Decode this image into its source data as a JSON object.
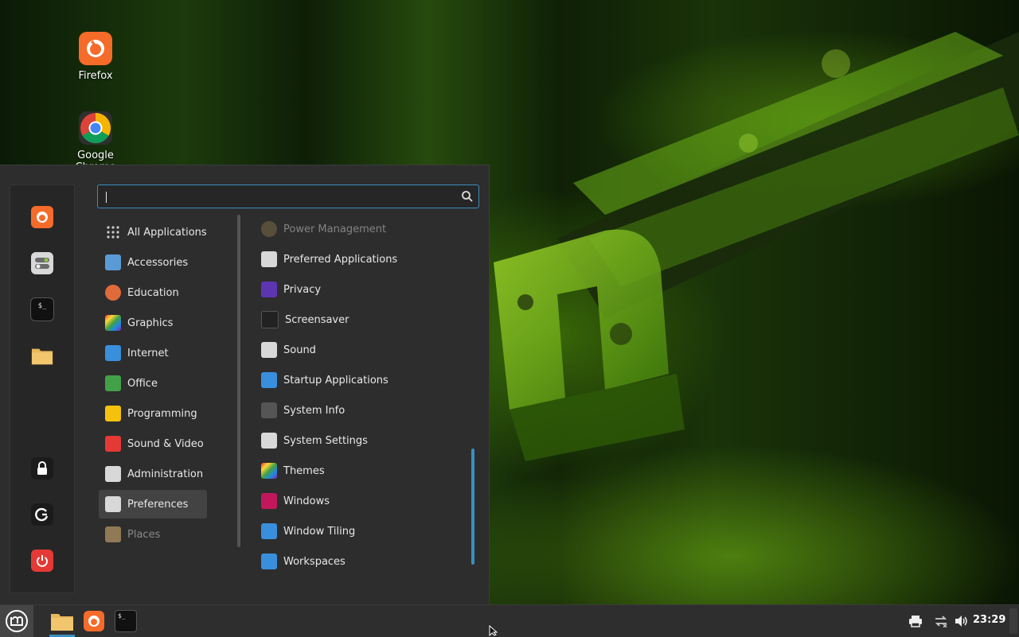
{
  "desktop": {
    "icons": [
      {
        "label": "Firefox",
        "icon": "firefox-icon"
      },
      {
        "label": "Google Chrome",
        "icon": "chrome-icon"
      }
    ]
  },
  "menu": {
    "search": {
      "value": "",
      "placeholder": ""
    },
    "favorites": [
      {
        "name": "firefox",
        "icon": "firefox-icon"
      },
      {
        "name": "system-settings",
        "icon": "settings-toggle-icon"
      },
      {
        "name": "terminal",
        "icon": "terminal-icon"
      },
      {
        "name": "files",
        "icon": "folder-icon"
      },
      {
        "name": "lock-screen",
        "icon": "lock-icon"
      },
      {
        "name": "logout",
        "icon": "logout-icon"
      },
      {
        "name": "shutdown",
        "icon": "power-icon"
      }
    ],
    "categories": [
      {
        "label": "All Applications",
        "icon": "grid-icon"
      },
      {
        "label": "Accessories",
        "icon": "accessories-icon"
      },
      {
        "label": "Education",
        "icon": "education-icon"
      },
      {
        "label": "Graphics",
        "icon": "graphics-icon"
      },
      {
        "label": "Internet",
        "icon": "cloud-icon"
      },
      {
        "label": "Office",
        "icon": "office-icon"
      },
      {
        "label": "Programming",
        "icon": "programming-icon"
      },
      {
        "label": "Sound & Video",
        "icon": "play-icon"
      },
      {
        "label": "Administration",
        "icon": "administration-icon"
      },
      {
        "label": "Preferences",
        "icon": "preferences-icon",
        "selected": true
      },
      {
        "label": "Places",
        "icon": "folder-icon"
      }
    ],
    "apps": [
      {
        "label": "Power Management",
        "icon": "power-management-icon"
      },
      {
        "label": "Preferred Applications",
        "icon": "preferred-apps-icon"
      },
      {
        "label": "Privacy",
        "icon": "privacy-mask-icon"
      },
      {
        "label": "Screensaver",
        "icon": "moon-icon"
      },
      {
        "label": "Sound",
        "icon": "speaker-icon"
      },
      {
        "label": "Startup Applications",
        "icon": "startup-icon"
      },
      {
        "label": "System Info",
        "icon": "system-info-icon"
      },
      {
        "label": "System Settings",
        "icon": "settings-toggle-icon"
      },
      {
        "label": "Themes",
        "icon": "themes-icon"
      },
      {
        "label": "Windows",
        "icon": "windows-icon"
      },
      {
        "label": "Window Tiling",
        "icon": "window-tiling-icon"
      },
      {
        "label": "Workspaces",
        "icon": "workspaces-icon"
      }
    ]
  },
  "taskbar": {
    "menu_button": "mint-logo-icon",
    "launchers": [
      "folder-icon",
      "firefox-icon",
      "terminal-icon"
    ],
    "tray": [
      "printer-icon",
      "network-icon",
      "volume-icon"
    ],
    "clock": "23:29"
  },
  "colors": {
    "accent": "#3a8fbf",
    "menu_bg": "#2d2d2d",
    "panel_bg": "#2e2e2e",
    "selected_bg": "#434343"
  }
}
